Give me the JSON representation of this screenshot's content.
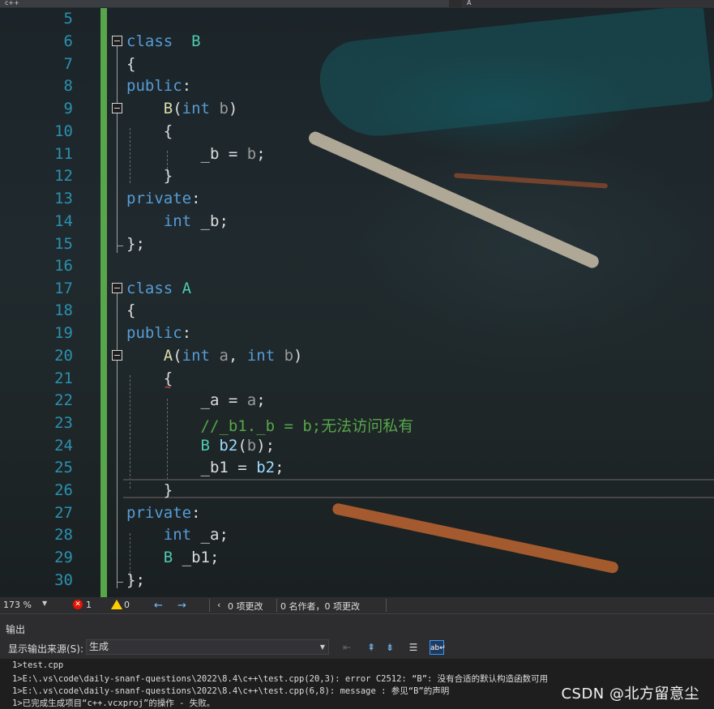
{
  "tabs": {
    "left": "c++",
    "right": "A"
  },
  "editor": {
    "line_numbers": [
      "5",
      "6",
      "7",
      "8",
      "9",
      "10",
      "11",
      "12",
      "13",
      "14",
      "15",
      "16",
      "17",
      "18",
      "19",
      "20",
      "21",
      "22",
      "23",
      "24",
      "25",
      "26",
      "27",
      "28",
      "29",
      "30"
    ],
    "lines": {
      "l6": [
        "class",
        "B"
      ],
      "l7": "{",
      "l8": [
        "public",
        ":"
      ],
      "l9": [
        "B",
        "(",
        "int",
        "b",
        ")"
      ],
      "l10": "{",
      "l11": [
        "_b",
        "=",
        "b",
        ";"
      ],
      "l12": "}",
      "l13": [
        "private",
        ":"
      ],
      "l14": [
        "int",
        "_b",
        ";"
      ],
      "l15": "};",
      "l17": [
        "class",
        "A"
      ],
      "l18": "{",
      "l19": [
        "public",
        ":"
      ],
      "l20": [
        "A",
        "(",
        "int",
        "a",
        ",",
        "int",
        "b",
        ")"
      ],
      "l21": "{",
      "l22": [
        "_a",
        "=",
        "a",
        ";"
      ],
      "l23": "//_b1._b = b;无法访问私有",
      "l24": [
        "B",
        "b2",
        "(",
        "b",
        ");"
      ],
      "l25": [
        "_b1",
        "=",
        "b2",
        ";"
      ],
      "l26": "}",
      "l27": [
        "private",
        ":"
      ],
      "l28": [
        "int",
        "_a",
        ";"
      ],
      "l29": [
        "B",
        "_b1",
        ";"
      ],
      "l30": "};"
    },
    "squiggle": "~"
  },
  "statusbar": {
    "zoom": "173 %",
    "errors": "1",
    "warnings": "0",
    "back_arrow": "←",
    "forward_arrow": "→",
    "changes": "0 项更改",
    "authors": "0 名作者，0 项更改"
  },
  "output": {
    "title": "输出",
    "source_label": "显示输出来源(S):",
    "source_value": "生成",
    "lines": [
      "1>test.cpp",
      "1>E:\\.vs\\code\\daily-snanf-questions\\2022\\8.4\\c++\\test.cpp(20,3): error C2512: “B”: 没有合适的默认构造函数可用",
      "1>E:\\.vs\\code\\daily-snanf-questions\\2022\\8.4\\c++\\test.cpp(6,8): message : 参见“B”的声明",
      "1>已完成生成项目“c++.vcxproj”的操作 - 失败。"
    ]
  },
  "watermark": "CSDN @北方留意尘",
  "colors": {
    "keyword": "#569cd6",
    "type": "#4ec9b0",
    "function": "#dcdcaa",
    "comment": "#57a64a",
    "line_number": "#2b91af",
    "change_bar": "#57a64a",
    "error": "#e51400"
  }
}
